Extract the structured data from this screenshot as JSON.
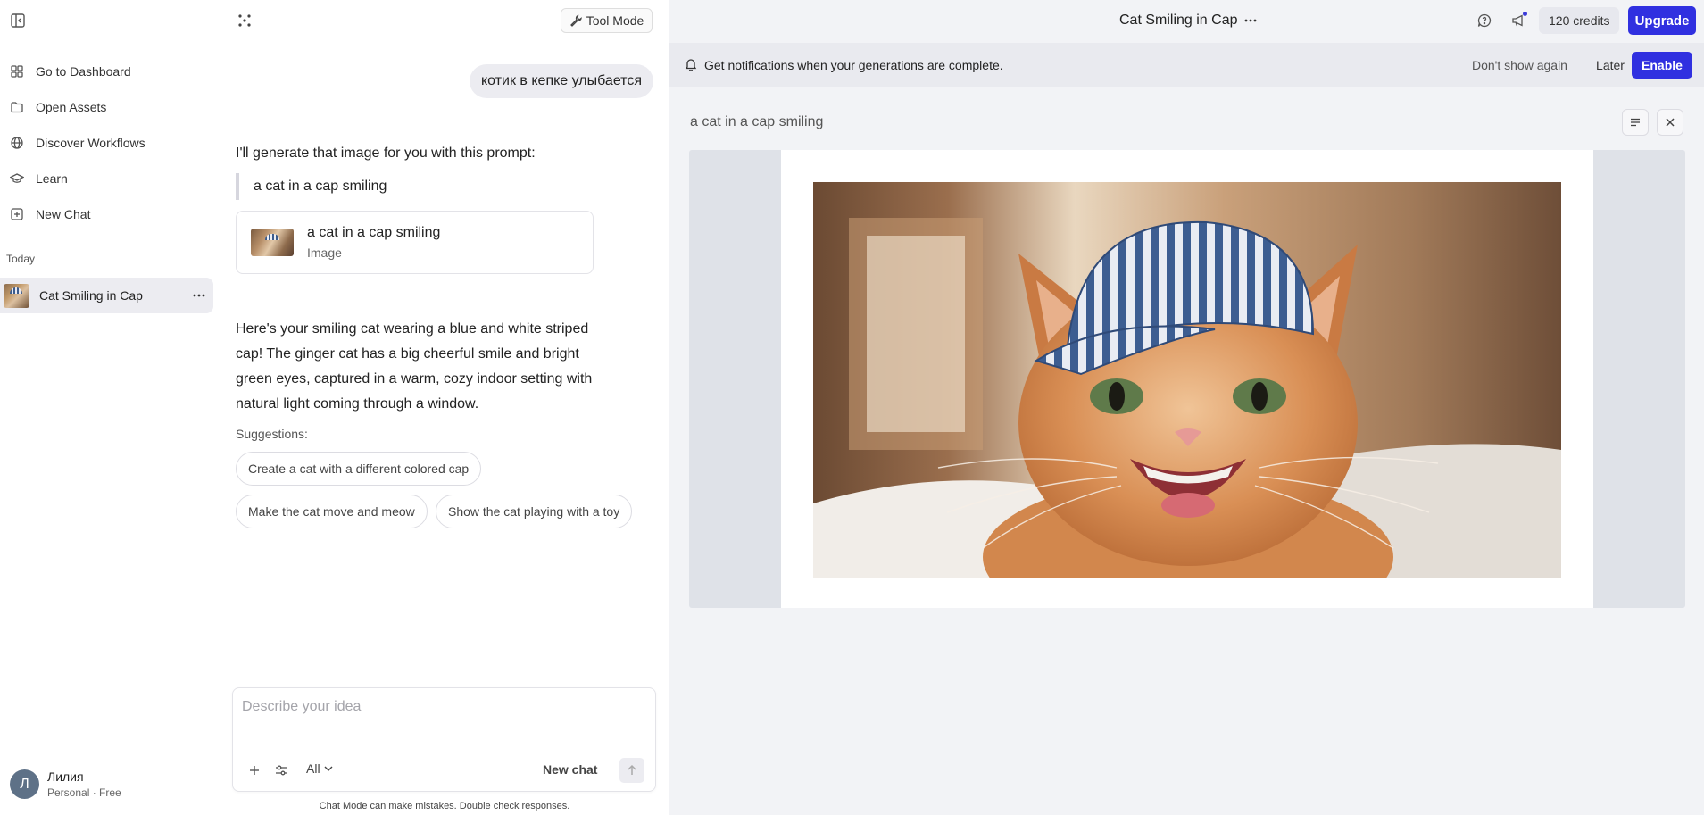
{
  "sidebar": {
    "nav": [
      {
        "label": "Go to Dashboard",
        "icon": "grid-icon"
      },
      {
        "label": "Open Assets",
        "icon": "folder-icon"
      },
      {
        "label": "Discover Workflows",
        "icon": "globe-icon"
      },
      {
        "label": "Learn",
        "icon": "graduation-cap-icon"
      },
      {
        "label": "New Chat",
        "icon": "plus-square-icon"
      }
    ],
    "section_today": "Today",
    "active_chat": "Cat Smiling in Cap",
    "user": {
      "initial": "Л",
      "name": "Лилия",
      "plan": "Personal · Free"
    }
  },
  "chat": {
    "tool_mode_label": "Tool Mode",
    "user_message": "котик в кепке улыбается",
    "ai_intro": "I'll generate that image for you with this prompt:",
    "prompt_quote": "a cat in a cap smiling",
    "asset": {
      "title": "a cat in a cap smiling",
      "type": "Image"
    },
    "ai_response": "Here's your smiling cat wearing a blue and white striped cap! The ginger cat has a big cheerful smile and bright green eyes, captured in a warm, cozy indoor setting with natural light coming through a window.",
    "suggestions_label": "Suggestions:",
    "suggestions": [
      "Create a cat with a different colored cap",
      "Make the cat move and meow",
      "Show the cat playing with a toy"
    ],
    "composer": {
      "placeholder": "Describe your idea",
      "mode": "All",
      "new_chat_label": "New chat"
    },
    "disclaimer": "Chat Mode can make mistakes. Double check responses."
  },
  "preview": {
    "title": "Cat Smiling in Cap",
    "credits": "120 credits",
    "upgrade_label": "Upgrade",
    "notification": {
      "text": "Get notifications when your generations are complete.",
      "dont_show": "Don't show again",
      "later": "Later",
      "enable": "Enable"
    },
    "prompt": "a cat in a cap smiling"
  },
  "colors": {
    "accent": "#3030e0",
    "sidebar_active": "#ececf1",
    "preview_bg": "#f2f3f6"
  }
}
